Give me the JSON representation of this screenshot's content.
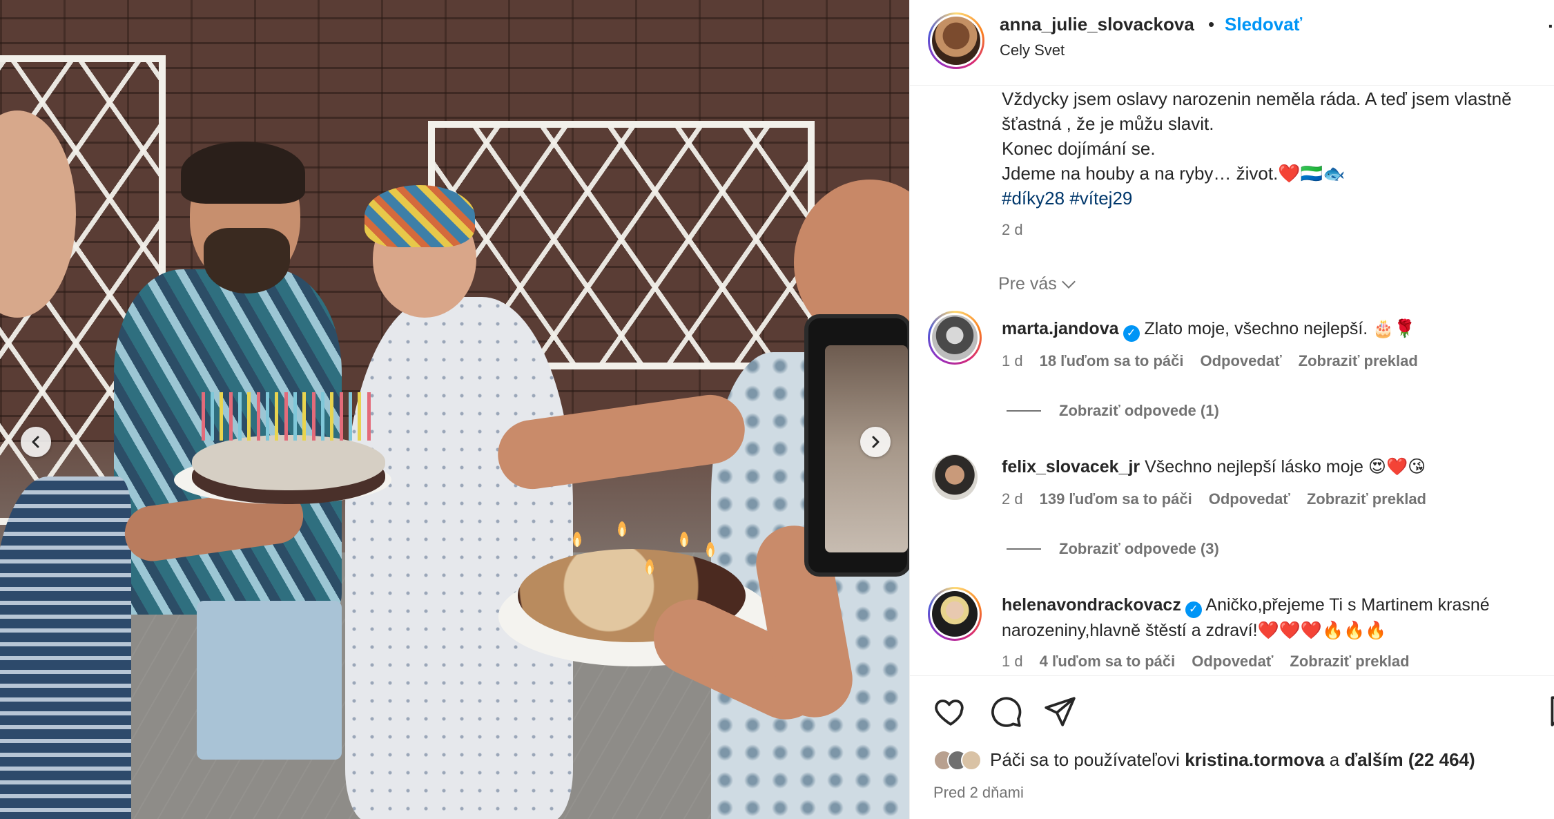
{
  "post": {
    "username": "anna_julie_slovackova",
    "dot": "•",
    "follow_label": "Sledovať",
    "location": "Cely Svet",
    "more": "·",
    "caption": {
      "line1": "Vždycky jsem oslavy narozenin neměla ráda. A teď jsem vlastně",
      "line2": "šťastná , že je můžu slavit.",
      "line3": "Konec dojímání se.",
      "line4": "Jdeme na houby a na ryby… život.❤️🇸🇱🐟",
      "hashtag1": "#díky28",
      "hashtag2": "#vítej29"
    },
    "caption_time": "2 d",
    "sort_label": "Pre vás"
  },
  "comments": [
    {
      "username": "marta.jandova",
      "verified": true,
      "text": "Zlato moje, všechno nejlepší. 🎂🌹",
      "time": "1 d",
      "likes": "18 ľuďom sa to páči",
      "reply": "Odpovedať",
      "translate": "Zobraziť preklad",
      "replies_label": "Zobraziť odpovede (1)"
    },
    {
      "username": "felix_slovacek_jr",
      "verified": false,
      "text": "Všechno nejlepší lásko moje 😍❤️😘",
      "time": "2 d",
      "likes": "139 ľuďom sa to páči",
      "reply": "Odpovedať",
      "translate": "Zobraziť preklad",
      "replies_label": "Zobraziť odpovede (3)"
    },
    {
      "username": "helenavondrackovacz",
      "verified": true,
      "text": "Aničko,přejeme Ti s Martinem krasné narozeniny,hlavně štěstí a zdraví!❤️❤️❤️🔥🔥🔥",
      "time": "1 d",
      "likes": "4 ľuďom sa to páči",
      "reply": "Odpovedať",
      "translate": "Zobraziť preklad"
    }
  ],
  "likes_bar": {
    "prefix": "Páči sa to používateľovi",
    "user": "kristina.tormova",
    "connector": "a",
    "others": "ďalším (22 464)"
  },
  "posted_ago": "Pred 2 dňami",
  "icons": {
    "prev": "chevron-left-icon",
    "next": "chevron-right-icon",
    "like": "heart-icon",
    "comment": "comment-icon",
    "share": "share-icon",
    "save": "bookmark-icon",
    "verified": "verified-badge-icon"
  },
  "colors": {
    "accent": "#0095f6",
    "hashtag": "#00376b",
    "muted": "#737373",
    "text": "#262626"
  }
}
